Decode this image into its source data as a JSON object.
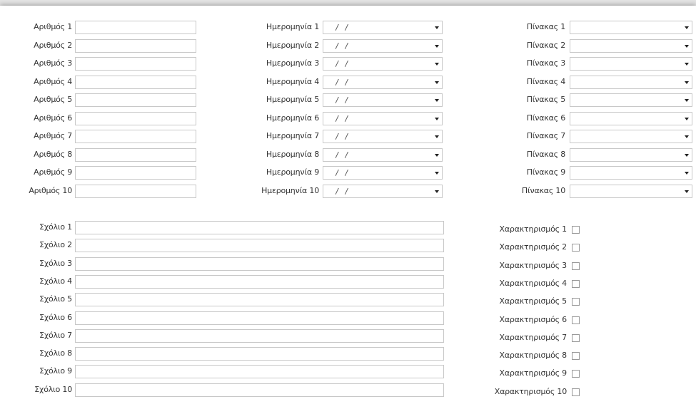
{
  "numbers": [
    {
      "label": "Αριθμός 1",
      "value": ""
    },
    {
      "label": "Αριθμός 2",
      "value": ""
    },
    {
      "label": "Αριθμός 3",
      "value": ""
    },
    {
      "label": "Αριθμός 4",
      "value": ""
    },
    {
      "label": "Αριθμός 5",
      "value": ""
    },
    {
      "label": "Αριθμός 6",
      "value": ""
    },
    {
      "label": "Αριθμός 7",
      "value": ""
    },
    {
      "label": "Αριθμός 8",
      "value": ""
    },
    {
      "label": "Αριθμός 9",
      "value": ""
    },
    {
      "label": "Αριθμός 10",
      "value": ""
    }
  ],
  "dates": [
    {
      "label": "Ημερομηνία 1",
      "value": "/  /"
    },
    {
      "label": "Ημερομηνία 2",
      "value": "/  /"
    },
    {
      "label": "Ημερομηνία 3",
      "value": "/  /"
    },
    {
      "label": "Ημερομηνία 4",
      "value": "/  /"
    },
    {
      "label": "Ημερομηνία 5",
      "value": "/  /"
    },
    {
      "label": "Ημερομηνία 6",
      "value": "/  /"
    },
    {
      "label": "Ημερομηνία 7",
      "value": "/  /"
    },
    {
      "label": "Ημερομηνία 8",
      "value": "/  /"
    },
    {
      "label": "Ημερομηνία 9",
      "value": "/  /"
    },
    {
      "label": "Ημερομηνία 10",
      "value": "/  /"
    }
  ],
  "tables": [
    {
      "label": "Πίνακας 1",
      "value": ""
    },
    {
      "label": "Πίνακας 2",
      "value": ""
    },
    {
      "label": "Πίνακας 3",
      "value": ""
    },
    {
      "label": "Πίνακας 4",
      "value": ""
    },
    {
      "label": "Πίνακας 5",
      "value": ""
    },
    {
      "label": "Πίνακας 6",
      "value": ""
    },
    {
      "label": "Πίνακας 7",
      "value": ""
    },
    {
      "label": "Πίνακας 8",
      "value": ""
    },
    {
      "label": "Πίνακας 9",
      "value": ""
    },
    {
      "label": "Πίνακας 10",
      "value": ""
    }
  ],
  "comments": [
    {
      "label": "Σχόλιο 1",
      "value": ""
    },
    {
      "label": "Σχόλιο 2",
      "value": ""
    },
    {
      "label": "Σχόλιο 3",
      "value": ""
    },
    {
      "label": "Σχόλιο 4",
      "value": ""
    },
    {
      "label": "Σχόλιο 5",
      "value": ""
    },
    {
      "label": "Σχόλιο 6",
      "value": ""
    },
    {
      "label": "Σχόλιο 7",
      "value": ""
    },
    {
      "label": "Σχόλιο 8",
      "value": ""
    },
    {
      "label": "Σχόλιο 9",
      "value": ""
    },
    {
      "label": "Σχόλιο 10",
      "value": ""
    }
  ],
  "flags": [
    {
      "label": "Χαρακτηρισμός 1",
      "checked": false
    },
    {
      "label": "Χαρακτηρισμός 2",
      "checked": false
    },
    {
      "label": "Χαρακτηρισμός 3",
      "checked": false
    },
    {
      "label": "Χαρακτηρισμός 4",
      "checked": false
    },
    {
      "label": "Χαρακτηρισμός 5",
      "checked": false
    },
    {
      "label": "Χαρακτηρισμός 6",
      "checked": false
    },
    {
      "label": "Χαρακτηρισμός 7",
      "checked": false
    },
    {
      "label": "Χαρακτηρισμός 8",
      "checked": false
    },
    {
      "label": "Χαρακτηρισμός 9",
      "checked": false
    },
    {
      "label": "Χαρακτηρισμός 10",
      "checked": false
    }
  ],
  "icons": {
    "dropdown": "chevron-down-icon",
    "checkbox": "checkbox-icon"
  }
}
